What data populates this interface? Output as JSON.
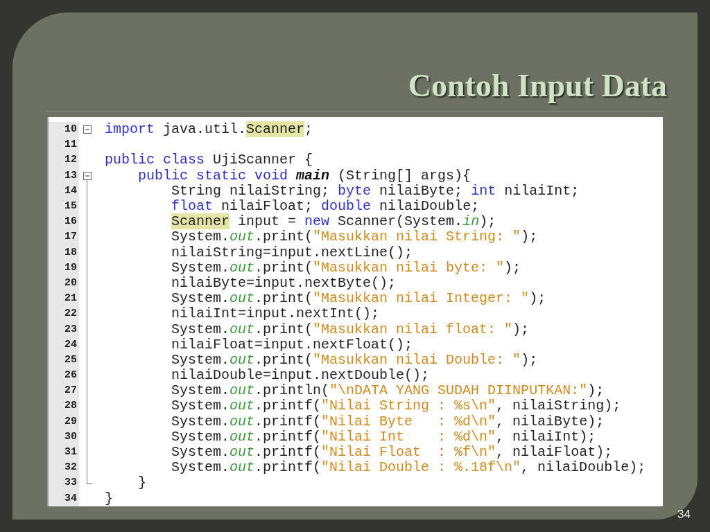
{
  "title": "Contoh Input Data",
  "code": {
    "lines": [
      {
        "number": "10",
        "kind": "fold-start",
        "tokens": [
          {
            "kind": "keyword",
            "text": "import"
          },
          {
            "kind": "plain",
            "text": " java.util."
          },
          {
            "kind": "highlight",
            "text": "Scanner"
          },
          {
            "kind": "plain",
            "text": ";"
          }
        ]
      },
      {
        "number": "11",
        "kind": "plain"
      },
      {
        "number": "12",
        "kind": "plain",
        "tokens": [
          {
            "kind": "keyword",
            "text": "public class"
          },
          {
            "kind": "plain",
            "text": " UjiScanner {"
          }
        ]
      },
      {
        "number": "13",
        "kind": "fold-open",
        "tokens": [
          {
            "kind": "keyword",
            "text": "    public static void "
          },
          {
            "kind": "method",
            "text": "main"
          },
          {
            "kind": "plain",
            "text": " (String[] args){"
          }
        ]
      },
      {
        "number": "14",
        "kind": "fold-body",
        "tokens": [
          {
            "kind": "plain",
            "text": "        String nilaiString; "
          },
          {
            "kind": "keyword",
            "text": "byte"
          },
          {
            "kind": "plain",
            "text": " nilaiByte; "
          },
          {
            "kind": "keyword",
            "text": "int"
          },
          {
            "kind": "plain",
            "text": " nilaiInt;"
          }
        ]
      },
      {
        "number": "15",
        "kind": "fold-body",
        "tokens": [
          {
            "kind": "keyword",
            "text": "        float"
          },
          {
            "kind": "plain",
            "text": " nilaiFloat; "
          },
          {
            "kind": "keyword",
            "text": "double"
          },
          {
            "kind": "plain",
            "text": " nilaiDouble;"
          }
        ]
      },
      {
        "number": "16",
        "kind": "fold-body",
        "tokens": [
          {
            "kind": "highlight",
            "text": "        Scanner"
          },
          {
            "kind": "plain",
            "text": " input = "
          },
          {
            "kind": "keyword",
            "text": "new"
          },
          {
            "kind": "plain",
            "text": " Scanner(System."
          },
          {
            "kind": "field",
            "text": "in"
          },
          {
            "kind": "plain",
            "text": ");"
          }
        ]
      },
      {
        "number": "17",
        "kind": "fold-body",
        "tokens": [
          {
            "kind": "plain",
            "text": "        System."
          },
          {
            "kind": "field",
            "text": "out"
          },
          {
            "kind": "plain",
            "text": ".print("
          },
          {
            "kind": "string",
            "text": "\"Masukkan nilai String: \""
          },
          {
            "kind": "plain",
            "text": ");"
          }
        ]
      },
      {
        "number": "18",
        "kind": "fold-body",
        "tokens": [
          {
            "kind": "plain",
            "text": "        nilaiString=input.nextLine();"
          }
        ]
      },
      {
        "number": "19",
        "kind": "fold-body",
        "tokens": [
          {
            "kind": "plain",
            "text": "        System."
          },
          {
            "kind": "field",
            "text": "out"
          },
          {
            "kind": "plain",
            "text": ".print("
          },
          {
            "kind": "string",
            "text": "\"Masukkan nilai byte: \""
          },
          {
            "kind": "plain",
            "text": ");"
          }
        ]
      },
      {
        "number": "20",
        "kind": "fold-body",
        "tokens": [
          {
            "kind": "plain",
            "text": "        nilaiByte=input.nextByte();"
          }
        ]
      },
      {
        "number": "21",
        "kind": "fold-body",
        "tokens": [
          {
            "kind": "plain",
            "text": "        System."
          },
          {
            "kind": "field",
            "text": "out"
          },
          {
            "kind": "plain",
            "text": ".print("
          },
          {
            "kind": "string",
            "text": "\"Masukkan nilai Integer: \""
          },
          {
            "kind": "plain",
            "text": ");"
          }
        ]
      },
      {
        "number": "22",
        "kind": "fold-body",
        "tokens": [
          {
            "kind": "plain",
            "text": "        nilaiInt=input.nextInt();"
          }
        ]
      },
      {
        "number": "23",
        "kind": "fold-body",
        "tokens": [
          {
            "kind": "plain",
            "text": "        System."
          },
          {
            "kind": "field",
            "text": "out"
          },
          {
            "kind": "plain",
            "text": ".print("
          },
          {
            "kind": "string",
            "text": "\"Masukkan nilai float: \""
          },
          {
            "kind": "plain",
            "text": ");"
          }
        ]
      },
      {
        "number": "24",
        "kind": "fold-body",
        "tokens": [
          {
            "kind": "plain",
            "text": "        nilaiFloat=input.nextFloat();"
          }
        ]
      },
      {
        "number": "25",
        "kind": "fold-body",
        "tokens": [
          {
            "kind": "plain",
            "text": "        System."
          },
          {
            "kind": "field",
            "text": "out"
          },
          {
            "kind": "plain",
            "text": ".print("
          },
          {
            "kind": "string",
            "text": "\"Masukkan nilai Double: \""
          },
          {
            "kind": "plain",
            "text": ");"
          }
        ]
      },
      {
        "number": "26",
        "kind": "fold-body",
        "tokens": [
          {
            "kind": "plain",
            "text": "        nilaiDouble=input.nextDouble();"
          }
        ]
      },
      {
        "number": "27",
        "kind": "fold-body",
        "tokens": [
          {
            "kind": "plain",
            "text": "        System."
          },
          {
            "kind": "field",
            "text": "out"
          },
          {
            "kind": "plain",
            "text": ".println("
          },
          {
            "kind": "string",
            "text": "\"\\nDATA YANG SUDAH DIINPUTKAN:\""
          },
          {
            "kind": "plain",
            "text": ");"
          }
        ]
      },
      {
        "number": "28",
        "kind": "fold-body",
        "tokens": [
          {
            "kind": "plain",
            "text": "        System."
          },
          {
            "kind": "field",
            "text": "out"
          },
          {
            "kind": "plain",
            "text": ".printf("
          },
          {
            "kind": "string",
            "text": "\"Nilai String : %s\\n\""
          },
          {
            "kind": "plain",
            "text": ", nilaiString);"
          }
        ]
      },
      {
        "number": "29",
        "kind": "fold-body",
        "tokens": [
          {
            "kind": "plain",
            "text": "        System."
          },
          {
            "kind": "field",
            "text": "out"
          },
          {
            "kind": "plain",
            "text": ".printf("
          },
          {
            "kind": "string",
            "text": "\"Nilai Byte   : %d\\n\""
          },
          {
            "kind": "plain",
            "text": ", nilaiByte);"
          }
        ]
      },
      {
        "number": "30",
        "kind": "fold-body",
        "tokens": [
          {
            "kind": "plain",
            "text": "        System."
          },
          {
            "kind": "field",
            "text": "out"
          },
          {
            "kind": "plain",
            "text": ".printf("
          },
          {
            "kind": "string",
            "text": "\"Nilai Int    : %d\\n\""
          },
          {
            "kind": "plain",
            "text": ", nilaiInt);"
          }
        ]
      },
      {
        "number": "31",
        "kind": "fold-body",
        "tokens": [
          {
            "kind": "plain",
            "text": "        System."
          },
          {
            "kind": "field",
            "text": "out"
          },
          {
            "kind": "plain",
            "text": ".printf("
          },
          {
            "kind": "string",
            "text": "\"Nilai Float  : %f\\n\""
          },
          {
            "kind": "plain",
            "text": ", nilaiFloat);"
          }
        ]
      },
      {
        "number": "32",
        "kind": "fold-body",
        "tokens": [
          {
            "kind": "plain",
            "text": "        System."
          },
          {
            "kind": "field",
            "text": "out"
          },
          {
            "kind": "plain",
            "text": ".printf("
          },
          {
            "kind": "string",
            "text": "\"Nilai Double : %.18f\\n\""
          },
          {
            "kind": "plain",
            "text": ", nilaiDouble);"
          }
        ]
      },
      {
        "number": "33",
        "kind": "fold-end",
        "tokens": [
          {
            "kind": "plain",
            "text": "    }"
          }
        ]
      },
      {
        "number": "34",
        "kind": "plain",
        "tokens": [
          {
            "kind": "plain",
            "text": "}"
          }
        ]
      }
    ]
  },
  "page_number": "34"
}
